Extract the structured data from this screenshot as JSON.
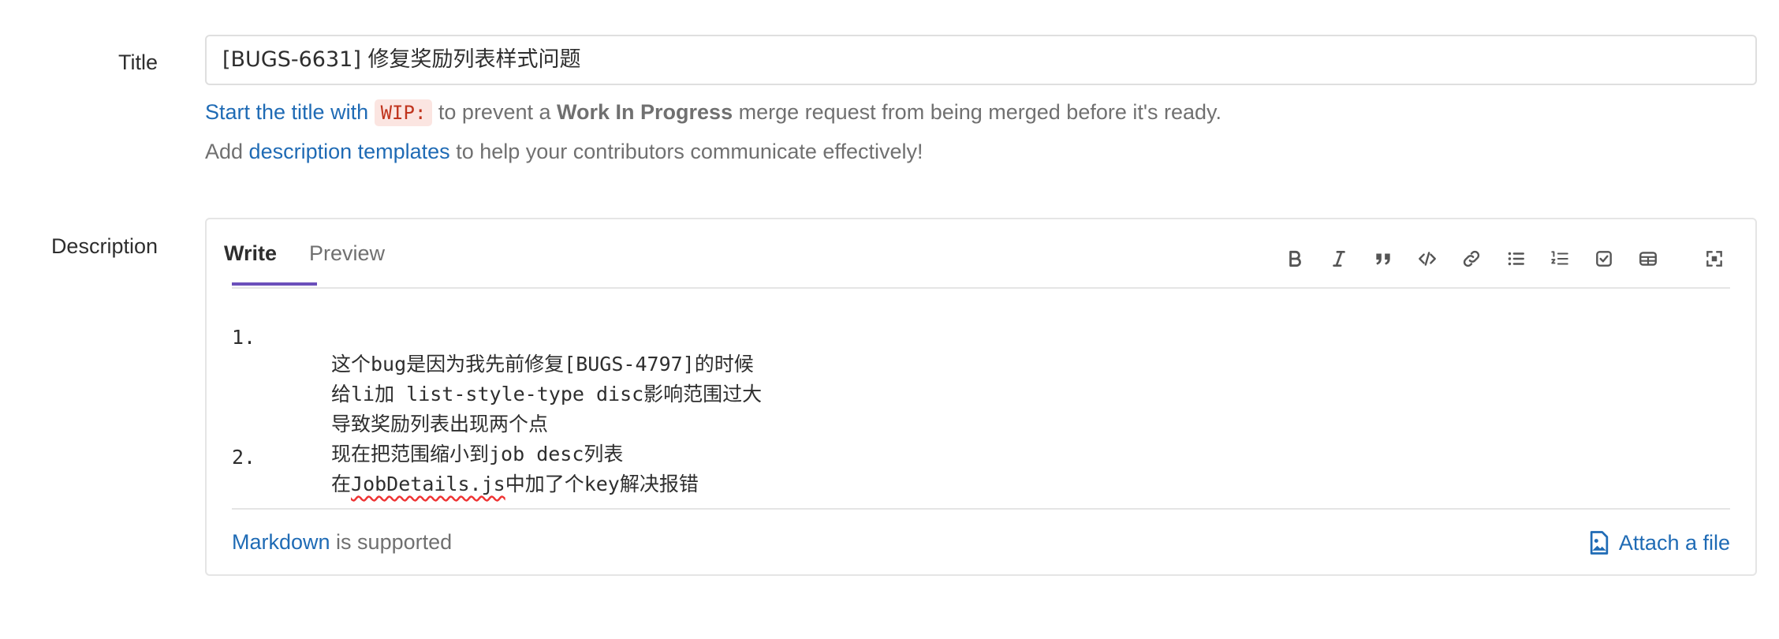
{
  "title_field": {
    "label": "Title",
    "value": "[BUGS-6631] 修复奖励列表样式问题"
  },
  "help": {
    "wip_link": "Start the title with",
    "wip_code": "WIP:",
    "wip_mid": " to prevent a ",
    "wip_bold": "Work In Progress",
    "wip_end": " merge request from being merged before it's ready.",
    "templates_pre": "Add ",
    "templates_link": "description templates",
    "templates_post": " to help your contributors communicate effectively!"
  },
  "description": {
    "label": "Description",
    "tabs": [
      {
        "label": "Write",
        "active": true
      },
      {
        "label": "Preview",
        "active": false
      }
    ],
    "toolbar_icons": [
      "bold-icon",
      "italic-icon",
      "quote-icon",
      "code-icon",
      "link-icon",
      "bullet-list-icon",
      "numbered-list-icon",
      "task-list-icon",
      "table-icon",
      "fullscreen-icon"
    ],
    "lines": [
      {
        "num": "1.",
        "text": "这个bug是因为我先前修复[BUGS-4797]的时候"
      },
      {
        "num": "",
        "text": "给li加 list-style-type disc影响范围过大"
      },
      {
        "num": "",
        "text": "导致奖励列表出现两个点"
      },
      {
        "num": "",
        "text": "现在把范围缩小到job desc列表"
      },
      {
        "num": "2.",
        "text_pre": "在",
        "text_spell": "JobDetails.js",
        "text_post": "中加了个key解决报错"
      }
    ],
    "markdown_link": "Markdown",
    "markdown_rest": " is supported",
    "attach_label": "Attach a file"
  },
  "colors": {
    "link": "#1f6bb5",
    "tab_active": "#6b4fbb",
    "code_bg": "#fbe5e1",
    "code_fg": "#c0341d"
  }
}
